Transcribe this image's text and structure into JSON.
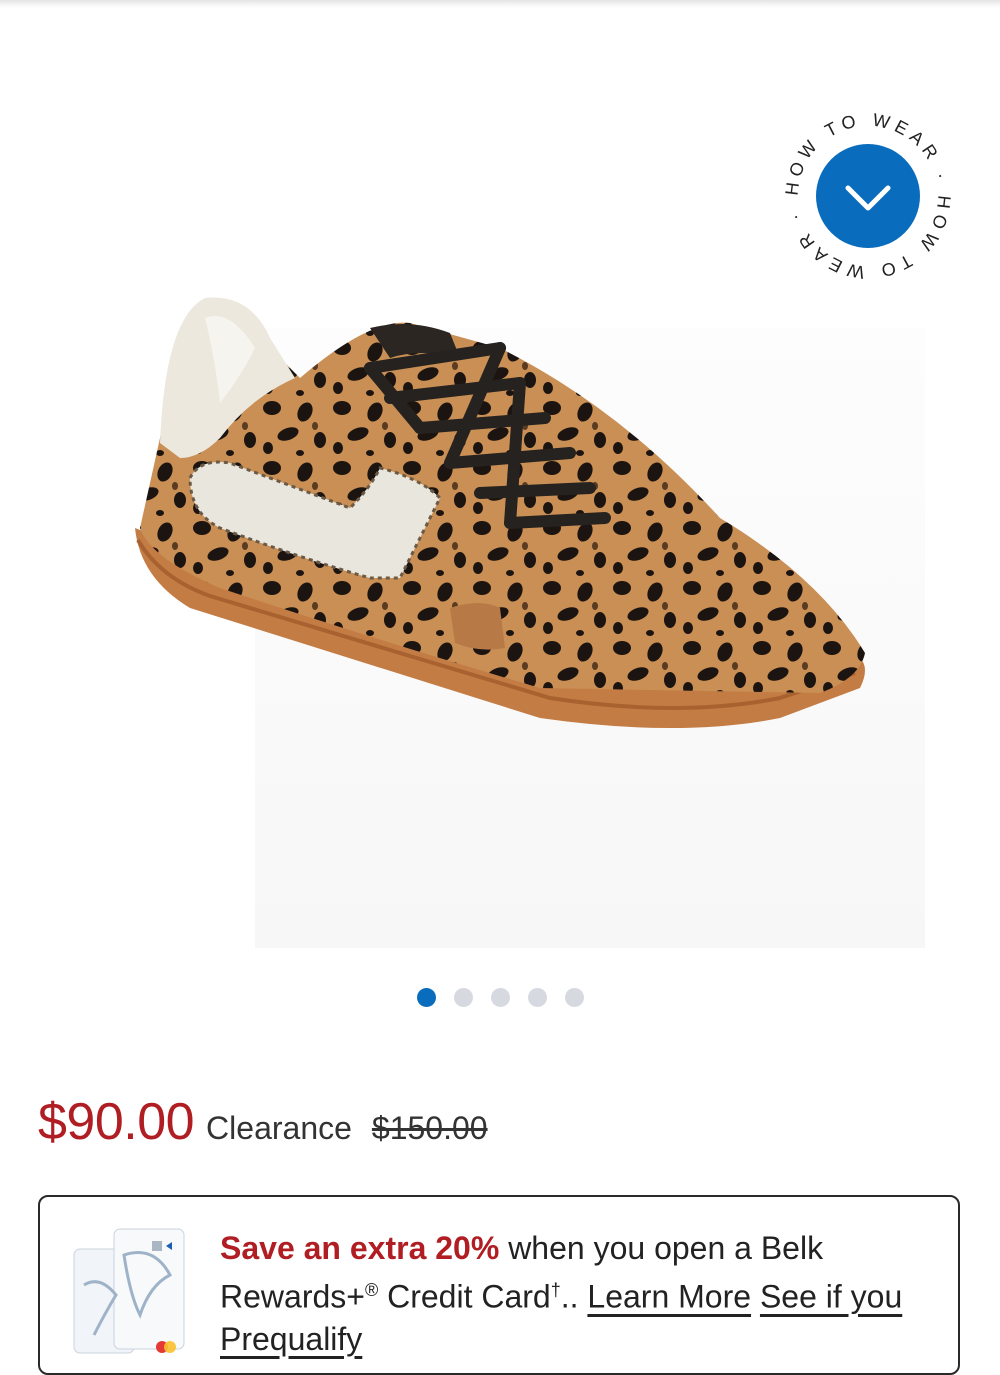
{
  "gallery": {
    "image_alt": "Leopard print calf hair low-top sneaker with white leather accents and gum sole",
    "how_to_wear_ring": "HOW TO WEAR · HOW TO WEAR · ",
    "dots": [
      true,
      false,
      false,
      false,
      false
    ]
  },
  "price": {
    "sale": "$90.00",
    "label": "Clearance",
    "original": "$150.00",
    "sale_color": "#b01e24"
  },
  "promo": {
    "strong": "Save an extra 20%",
    "text_1": " when you open a Belk Rewards+",
    "reg": "®",
    "text_2": " Credit Card",
    "dagger": "†",
    "text_3": ".. ",
    "learn_more": "Learn More",
    "see_if": "See if you Prequalify"
  },
  "colors": {
    "accent": "#0a6cbd",
    "sale": "#b01e24"
  }
}
